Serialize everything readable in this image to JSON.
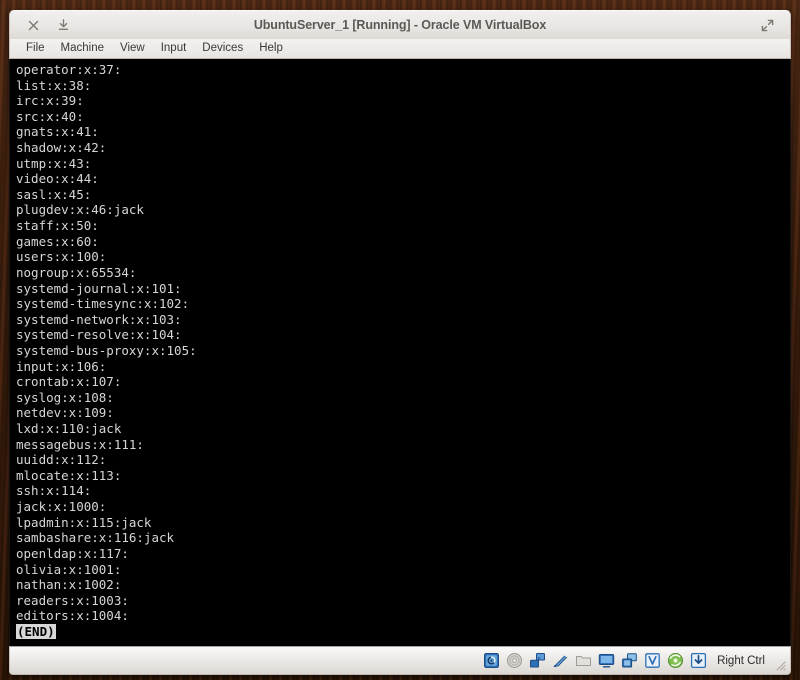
{
  "window": {
    "title": "UbuntuServer_1 [Running] - Oracle VM VirtualBox",
    "buttons": {
      "close": "close-button",
      "minimize": "minimize-button",
      "maximize": "maximize-button"
    }
  },
  "menubar": {
    "items": [
      {
        "label": "File"
      },
      {
        "label": "Machine"
      },
      {
        "label": "View"
      },
      {
        "label": "Input"
      },
      {
        "label": "Devices"
      },
      {
        "label": "Help"
      }
    ]
  },
  "terminal": {
    "lines": [
      "operator:x:37:",
      "list:x:38:",
      "irc:x:39:",
      "src:x:40:",
      "gnats:x:41:",
      "shadow:x:42:",
      "utmp:x:43:",
      "video:x:44:",
      "sasl:x:45:",
      "plugdev:x:46:jack",
      "staff:x:50:",
      "games:x:60:",
      "users:x:100:",
      "nogroup:x:65534:",
      "systemd-journal:x:101:",
      "systemd-timesync:x:102:",
      "systemd-network:x:103:",
      "systemd-resolve:x:104:",
      "systemd-bus-proxy:x:105:",
      "input:x:106:",
      "crontab:x:107:",
      "syslog:x:108:",
      "netdev:x:109:",
      "lxd:x:110:jack",
      "messagebus:x:111:",
      "uuidd:x:112:",
      "mlocate:x:113:",
      "ssh:x:114:",
      "jack:x:1000:",
      "lpadmin:x:115:jack",
      "sambashare:x:116:jack",
      "openldap:x:117:",
      "olivia:x:1001:",
      "nathan:x:1002:",
      "readers:x:1003:",
      "editors:x:1004:"
    ],
    "pager_marker": "(END)"
  },
  "statusbar": {
    "icons": [
      {
        "name": "hard-disk-icon",
        "state": "active"
      },
      {
        "name": "optical-disk-icon",
        "state": "inactive"
      },
      {
        "name": "network-adapters-icon",
        "state": "active"
      },
      {
        "name": "usb-devices-icon",
        "state": "active"
      },
      {
        "name": "shared-folders-icon",
        "state": "inactive"
      },
      {
        "name": "display-icon",
        "state": "active"
      },
      {
        "name": "video-capture-icon",
        "state": "active"
      },
      {
        "name": "virtualbox-guest-additions-icon",
        "state": "active"
      },
      {
        "name": "remote-desktop-icon",
        "state": "active"
      },
      {
        "name": "mouse-integration-icon",
        "state": "active"
      }
    ],
    "host_key": "Right Ctrl"
  },
  "colors": {
    "desktop": "#43220f",
    "chrome": "#e9e6e3",
    "screen_background": "#000000",
    "terminal_text": "#d6d6d6",
    "pager_highlight": "#d8d8d8"
  }
}
